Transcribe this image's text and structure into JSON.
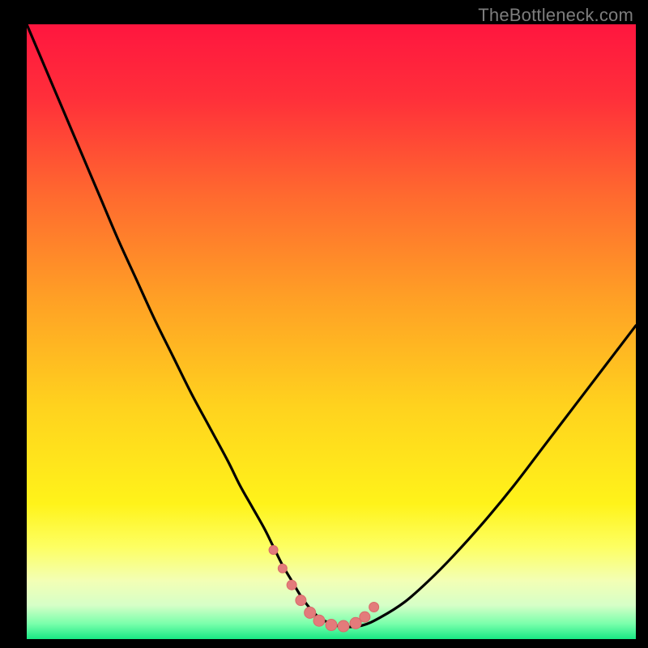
{
  "attribution": "TheBottleneck.com",
  "colors": {
    "frame": "#000000",
    "gradient_stops": [
      {
        "offset": 0.0,
        "color": "#ff163f"
      },
      {
        "offset": 0.12,
        "color": "#ff2f3a"
      },
      {
        "offset": 0.28,
        "color": "#ff6a2f"
      },
      {
        "offset": 0.45,
        "color": "#ffa125"
      },
      {
        "offset": 0.62,
        "color": "#ffd21e"
      },
      {
        "offset": 0.78,
        "color": "#fff31a"
      },
      {
        "offset": 0.85,
        "color": "#fdff62"
      },
      {
        "offset": 0.905,
        "color": "#f3ffb5"
      },
      {
        "offset": 0.945,
        "color": "#d6ffc7"
      },
      {
        "offset": 0.975,
        "color": "#7affab"
      },
      {
        "offset": 1.0,
        "color": "#18e884"
      }
    ],
    "curve": "#000000",
    "marker_fill": "#e37b7b",
    "marker_stroke": "#d96a6a"
  },
  "chart_data": {
    "type": "line",
    "title": "",
    "xlabel": "",
    "ylabel": "",
    "xlim": [
      0,
      100
    ],
    "ylim": [
      0,
      100
    ],
    "grid": false,
    "series": [
      {
        "name": "bottleneck-curve",
        "x": [
          0,
          3,
          6,
          9,
          12,
          15,
          18,
          21,
          24,
          27,
          30,
          33,
          35,
          37,
          39,
          40.5,
          42,
          43.5,
          45,
          46.5,
          48,
          50,
          52,
          55,
          58,
          62,
          66,
          70,
          75,
          80,
          85,
          90,
          95,
          100
        ],
        "y": [
          100,
          93,
          86,
          79,
          72,
          65,
          58.5,
          52,
          46,
          40,
          34.5,
          29,
          25,
          21.5,
          18,
          15,
          12,
          9.5,
          7,
          5,
          3.5,
          2.5,
          2,
          2.2,
          3.5,
          6,
          9.5,
          13.5,
          19,
          25,
          31.5,
          38,
          44.5,
          51
        ]
      }
    ],
    "markers": {
      "name": "highlight-dots",
      "x": [
        40.5,
        42,
        43.5,
        45,
        46.5,
        48,
        50,
        52,
        54,
        55.5,
        57
      ],
      "y": [
        14.5,
        11.5,
        8.8,
        6.3,
        4.3,
        3.0,
        2.3,
        2.1,
        2.6,
        3.6,
        5.2
      ],
      "r": [
        5.5,
        5.5,
        6,
        6.5,
        7,
        7,
        7,
        7,
        7,
        6.5,
        6
      ]
    }
  }
}
